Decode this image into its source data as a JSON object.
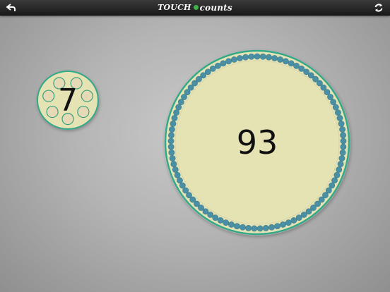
{
  "header": {
    "title_a": "TOUCH",
    "title_b": "counts",
    "back_icon": "back-arrow-icon",
    "refresh_icon": "refresh-icon"
  },
  "colors": {
    "disc_fill": "#e5e3b4",
    "disc_border": "#33a98a",
    "dot_teal": "#4a8fa3",
    "dot_empty": "#e6d9b6",
    "dot_empty_stroke": "#3aa27f",
    "title_dot": "#3fb24a"
  },
  "counters": [
    {
      "value": "7",
      "dots": 7,
      "style": "empty-rings"
    },
    {
      "value": "93",
      "dots": 93,
      "style": "filled-ring"
    }
  ]
}
